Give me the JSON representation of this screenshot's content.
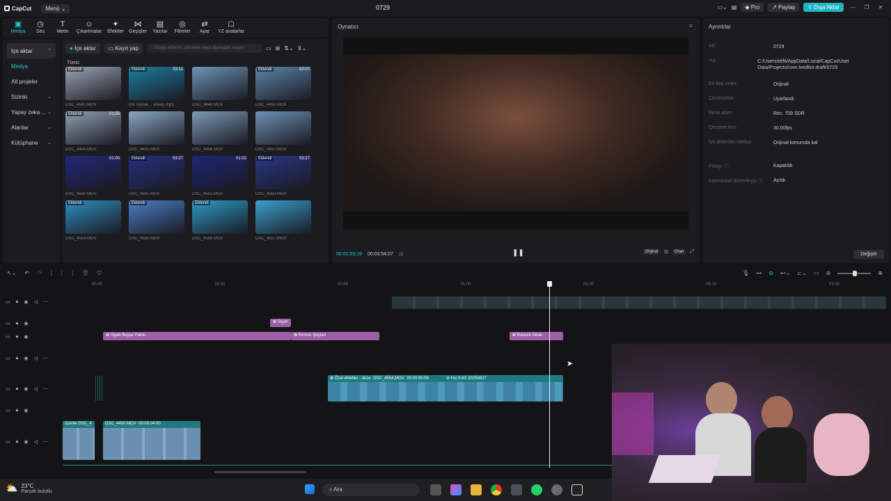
{
  "titlebar": {
    "logo": "CapCut",
    "menu": "Menü",
    "project": "0729",
    "pro": "Pro",
    "share": "Paylaş",
    "export": "Dışa Aktar"
  },
  "tools": [
    {
      "label": "Medya",
      "icon": "▣",
      "active": true
    },
    {
      "label": "Ses",
      "icon": "◷"
    },
    {
      "label": "Metin",
      "icon": "T"
    },
    {
      "label": "Çıkartmalar",
      "icon": "☺"
    },
    {
      "label": "Efektler",
      "icon": "✦"
    },
    {
      "label": "Geçişler",
      "icon": "⋈"
    },
    {
      "label": "Yazılar",
      "icon": "▤"
    },
    {
      "label": "Filtreler",
      "icon": "◎"
    },
    {
      "label": "Ayar",
      "icon": "⇄"
    },
    {
      "label": "YZ avatarlar",
      "icon": "☖"
    }
  ],
  "sidebar": [
    {
      "label": "İçe aktar",
      "chev": "⌃",
      "selected": true
    },
    {
      "label": "Medya",
      "teal": true
    },
    {
      "label": "Alt projeler"
    },
    {
      "label": "Sizinki",
      "chev": "⌄"
    },
    {
      "label": "Yapay zeka ...",
      "chev": "⌄"
    },
    {
      "label": "Alanlar",
      "chev": "⌄"
    },
    {
      "label": "Kütüphane",
      "chev": "⌄"
    }
  ],
  "media": {
    "import": "İçe aktar",
    "record": "Kayıt yap",
    "search_placeholder": "Dosya adlarını, sahneleri veya diyalogları arayın",
    "all": "Tümü",
    "items": [
      {
        "name": "DSC_4561.MOV",
        "badge": "Eklendi",
        "dur": "",
        "color": "#9aa6b5"
      },
      {
        "name": "Elif Toprak... Vokal).mp3",
        "badge": "Eklendi",
        "dur": "03:11",
        "color": "#1e7ea3"
      },
      {
        "name": "DSC_4449.MOV",
        "badge": "",
        "dur": "",
        "color": "#6d95b8"
      },
      {
        "name": "DSC_4450.MOV",
        "badge": "Eklendi",
        "dur": "02:07",
        "color": "#5d86aa"
      },
      {
        "name": "DSC_4454.MOV",
        "badge": "Eklendi",
        "dur": "01:55",
        "color": "#8fa0b2"
      },
      {
        "name": "DSC_4455.MOV",
        "badge": "",
        "dur": "",
        "color": "#8aa7c4"
      },
      {
        "name": "DSC_4456.MOV",
        "badge": "",
        "dur": "",
        "color": "#7c9ab6"
      },
      {
        "name": "DSC_4457.MOV",
        "badge": "",
        "dur": "",
        "color": "#6f92b4"
      },
      {
        "name": "DSC_4550.MOV",
        "badge": "",
        "dur": "01:00",
        "color": "#23287a"
      },
      {
        "name": "DSC_4551.MOV",
        "badge": "Eklendi",
        "dur": "03:27",
        "color": "#25307f"
      },
      {
        "name": "DSC_4552.MOV",
        "badge": "",
        "dur": "01:02",
        "color": "#1d2677"
      },
      {
        "name": "DSC_4553.MOV",
        "badge": "Eklendi",
        "dur": "03:27",
        "color": "#2a3686"
      },
      {
        "name": "DSC_4554.MOV",
        "badge": "Eklendi",
        "dur": "",
        "color": "#2f8ec0"
      },
      {
        "name": "DSC_4555.MOV",
        "badge": "Eklendi",
        "dur": "",
        "color": "#4a7ec7"
      },
      {
        "name": "DSC_4556.MOV",
        "badge": "Eklendi",
        "dur": "",
        "color": "#2c9bc9"
      },
      {
        "name": "DSC_4557.MOV",
        "badge": "",
        "dur": "",
        "color": "#3aa0cf"
      }
    ]
  },
  "player": {
    "title": "Oynatıcı",
    "current": "00:01:03:19",
    "total": "00:03:54:07",
    "btn_orig": "Orijinal",
    "btn_ratio": "Oran"
  },
  "details": {
    "title": "Ayrıntılar",
    "rows": [
      {
        "k": "Ad:",
        "v": "0729"
      },
      {
        "k": "Yol:",
        "v": "C:/Users/elifti/AppData/Local/CapCut/User Data/Projects/com.lveditor.draft/0729"
      },
      {
        "k": "En boy oranı:",
        "v": "Orijinal"
      },
      {
        "k": "Çözünürlük:",
        "v": "Uyarlandı"
      },
      {
        "k": "Renk alanı:",
        "v": "Rec. 709 SDR"
      },
      {
        "k": "Çerçeve hızı:",
        "v": "30.00fps"
      },
      {
        "k": "İçe aktarılan medya:",
        "v": "Orijinal konumda kal"
      },
      {
        "k": "Proxy: ⓘ",
        "v": "Kapatıldı"
      },
      {
        "k": "Katmanları düzenleyin ⓘ",
        "v": "Açıldı"
      }
    ],
    "change": "Değiştir"
  },
  "ruler": [
    "00:45",
    "00:50",
    "00:55",
    "01:00",
    "01:05",
    "01:10",
    "01:15"
  ],
  "clips": {
    "siyah": "Siyah",
    "siyah_beyaz": "Siyah Beyaz Panlu",
    "kirmizi": "Kırmızı Şeytan",
    "bulanik": "Bulanık Odak",
    "ozel": "Özel efektler - düze",
    "ozel_name": "DSC_4554.MOV",
    "ozel_dur": "00:00:05:08",
    "hiz": "Hız 0.6X",
    "hiz_date": "20250627",
    "main1": "üzenle",
    "main1b": "DSC_4",
    "main2": "DSC_4450.MOV",
    "main2_dur": "00:00:04:00"
  },
  "taskbar": {
    "temp": "23°C",
    "weather": "Parçalı bulutlu",
    "search": "Ara"
  }
}
